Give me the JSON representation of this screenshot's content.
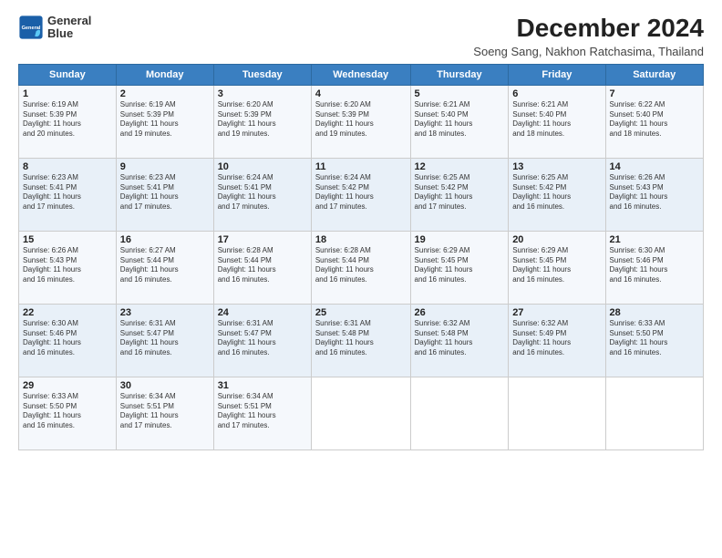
{
  "header": {
    "logo_line1": "General",
    "logo_line2": "Blue",
    "month_title": "December 2024",
    "subtitle": "Soeng Sang, Nakhon Ratchasima, Thailand"
  },
  "days_of_week": [
    "Sunday",
    "Monday",
    "Tuesday",
    "Wednesday",
    "Thursday",
    "Friday",
    "Saturday"
  ],
  "weeks": [
    [
      {
        "day": "1",
        "info": "Sunrise: 6:19 AM\nSunset: 5:39 PM\nDaylight: 11 hours\nand 20 minutes."
      },
      {
        "day": "2",
        "info": "Sunrise: 6:19 AM\nSunset: 5:39 PM\nDaylight: 11 hours\nand 19 minutes."
      },
      {
        "day": "3",
        "info": "Sunrise: 6:20 AM\nSunset: 5:39 PM\nDaylight: 11 hours\nand 19 minutes."
      },
      {
        "day": "4",
        "info": "Sunrise: 6:20 AM\nSunset: 5:39 PM\nDaylight: 11 hours\nand 19 minutes."
      },
      {
        "day": "5",
        "info": "Sunrise: 6:21 AM\nSunset: 5:40 PM\nDaylight: 11 hours\nand 18 minutes."
      },
      {
        "day": "6",
        "info": "Sunrise: 6:21 AM\nSunset: 5:40 PM\nDaylight: 11 hours\nand 18 minutes."
      },
      {
        "day": "7",
        "info": "Sunrise: 6:22 AM\nSunset: 5:40 PM\nDaylight: 11 hours\nand 18 minutes."
      }
    ],
    [
      {
        "day": "8",
        "info": "Sunrise: 6:23 AM\nSunset: 5:41 PM\nDaylight: 11 hours\nand 17 minutes."
      },
      {
        "day": "9",
        "info": "Sunrise: 6:23 AM\nSunset: 5:41 PM\nDaylight: 11 hours\nand 17 minutes."
      },
      {
        "day": "10",
        "info": "Sunrise: 6:24 AM\nSunset: 5:41 PM\nDaylight: 11 hours\nand 17 minutes."
      },
      {
        "day": "11",
        "info": "Sunrise: 6:24 AM\nSunset: 5:42 PM\nDaylight: 11 hours\nand 17 minutes."
      },
      {
        "day": "12",
        "info": "Sunrise: 6:25 AM\nSunset: 5:42 PM\nDaylight: 11 hours\nand 17 minutes."
      },
      {
        "day": "13",
        "info": "Sunrise: 6:25 AM\nSunset: 5:42 PM\nDaylight: 11 hours\nand 16 minutes."
      },
      {
        "day": "14",
        "info": "Sunrise: 6:26 AM\nSunset: 5:43 PM\nDaylight: 11 hours\nand 16 minutes."
      }
    ],
    [
      {
        "day": "15",
        "info": "Sunrise: 6:26 AM\nSunset: 5:43 PM\nDaylight: 11 hours\nand 16 minutes."
      },
      {
        "day": "16",
        "info": "Sunrise: 6:27 AM\nSunset: 5:44 PM\nDaylight: 11 hours\nand 16 minutes."
      },
      {
        "day": "17",
        "info": "Sunrise: 6:28 AM\nSunset: 5:44 PM\nDaylight: 11 hours\nand 16 minutes."
      },
      {
        "day": "18",
        "info": "Sunrise: 6:28 AM\nSunset: 5:44 PM\nDaylight: 11 hours\nand 16 minutes."
      },
      {
        "day": "19",
        "info": "Sunrise: 6:29 AM\nSunset: 5:45 PM\nDaylight: 11 hours\nand 16 minutes."
      },
      {
        "day": "20",
        "info": "Sunrise: 6:29 AM\nSunset: 5:45 PM\nDaylight: 11 hours\nand 16 minutes."
      },
      {
        "day": "21",
        "info": "Sunrise: 6:30 AM\nSunset: 5:46 PM\nDaylight: 11 hours\nand 16 minutes."
      }
    ],
    [
      {
        "day": "22",
        "info": "Sunrise: 6:30 AM\nSunset: 5:46 PM\nDaylight: 11 hours\nand 16 minutes."
      },
      {
        "day": "23",
        "info": "Sunrise: 6:31 AM\nSunset: 5:47 PM\nDaylight: 11 hours\nand 16 minutes."
      },
      {
        "day": "24",
        "info": "Sunrise: 6:31 AM\nSunset: 5:47 PM\nDaylight: 11 hours\nand 16 minutes."
      },
      {
        "day": "25",
        "info": "Sunrise: 6:31 AM\nSunset: 5:48 PM\nDaylight: 11 hours\nand 16 minutes."
      },
      {
        "day": "26",
        "info": "Sunrise: 6:32 AM\nSunset: 5:48 PM\nDaylight: 11 hours\nand 16 minutes."
      },
      {
        "day": "27",
        "info": "Sunrise: 6:32 AM\nSunset: 5:49 PM\nDaylight: 11 hours\nand 16 minutes."
      },
      {
        "day": "28",
        "info": "Sunrise: 6:33 AM\nSunset: 5:50 PM\nDaylight: 11 hours\nand 16 minutes."
      }
    ],
    [
      {
        "day": "29",
        "info": "Sunrise: 6:33 AM\nSunset: 5:50 PM\nDaylight: 11 hours\nand 16 minutes."
      },
      {
        "day": "30",
        "info": "Sunrise: 6:34 AM\nSunset: 5:51 PM\nDaylight: 11 hours\nand 17 minutes."
      },
      {
        "day": "31",
        "info": "Sunrise: 6:34 AM\nSunset: 5:51 PM\nDaylight: 11 hours\nand 17 minutes."
      },
      {
        "day": "",
        "info": ""
      },
      {
        "day": "",
        "info": ""
      },
      {
        "day": "",
        "info": ""
      },
      {
        "day": "",
        "info": ""
      }
    ]
  ]
}
